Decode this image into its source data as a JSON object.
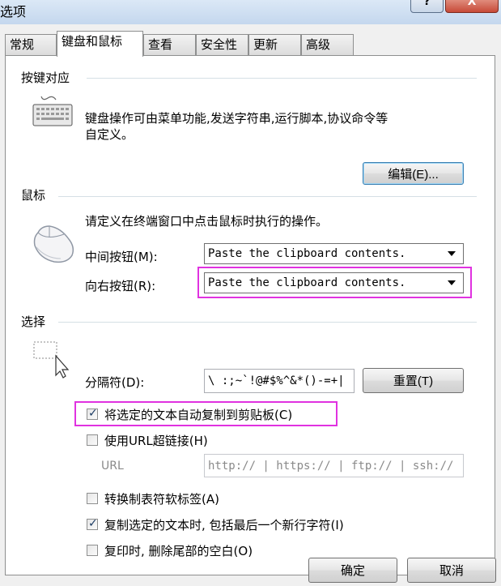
{
  "window": {
    "title": "选项",
    "help_label": "?",
    "close_label": "X"
  },
  "tabs": [
    {
      "label": "常规"
    },
    {
      "label": "键盘和鼠标"
    },
    {
      "label": "查看"
    },
    {
      "label": "安全性"
    },
    {
      "label": "更新"
    },
    {
      "label": "高级"
    }
  ],
  "keyboard": {
    "title": "按键对应",
    "desc_line1": "键盘操作可由菜单功能,发送字符串,运行脚本,协议命令等",
    "desc_line2": "自定义。",
    "edit_button": "编辑(E)..."
  },
  "mouse": {
    "title": "鼠标",
    "desc": "请定义在终端窗口中点击鼠标时执行的操作。",
    "middle_label": "中间按钮(M):",
    "middle_value": "Paste the clipboard contents.",
    "right_label": "向右按钮(R):",
    "right_value": "Paste the clipboard contents."
  },
  "selection": {
    "title": "选择",
    "delimiter_label": "分隔符(D):",
    "delimiter_value": "\\ :;~`!@#$%^&*()-=+|",
    "reset_button": "重置(T)",
    "auto_copy_label": "将选定的文本自动复制到剪贴板(C)",
    "use_url_label": "使用URL超链接(H)",
    "url_label": "URL",
    "url_value": "http:// | https:// | ftp:// | ssh://",
    "convert_tabs_label": "转换制表符软标签(A)",
    "include_newline_label": "复制选定的文本时, 包括最后一个新行字符(I)",
    "trim_spaces_label": "复印时, 删除尾部的空白(O)"
  },
  "checkboxes": {
    "auto_copy": true,
    "use_url": false,
    "convert_tabs": false,
    "include_newline": true,
    "trim_spaces": false
  },
  "footer": {
    "ok": "确定",
    "cancel": "取消"
  },
  "colors": {
    "highlight": "#e032e0"
  }
}
